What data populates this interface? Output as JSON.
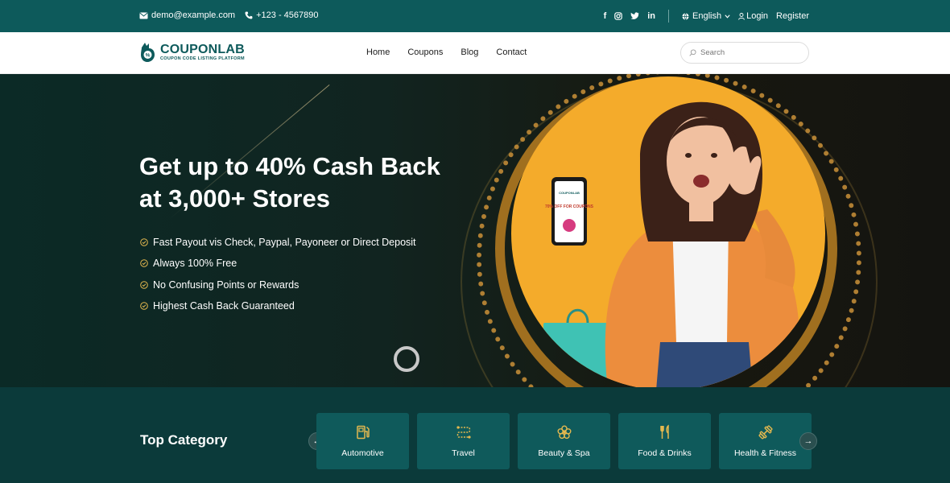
{
  "topbar": {
    "email": "demo@example.com",
    "phone": "+123 - 4567890",
    "social": [
      "f",
      "ig",
      "tw",
      "in"
    ],
    "language": "English",
    "login": "Login",
    "register": "Register"
  },
  "header": {
    "logo_title": "COUPONLAB",
    "logo_subtitle": "COUPON CODE LISTING PLATFORM",
    "nav": [
      "Home",
      "Coupons",
      "Blog",
      "Contact"
    ],
    "search_placeholder": "Search"
  },
  "hero": {
    "title_line1": "Get up to 40% Cash Back",
    "title_line2": "at 3,000+ Stores",
    "bullets": [
      "Fast Payout vis Check, Paypal, Payoneer or Direct Deposit",
      "Always 100% Free",
      "No Confusing Points or Rewards",
      "Highest Cash Back Guaranteed"
    ],
    "phone_screen_text": "70% OFF FOR COUPONS"
  },
  "category": {
    "title": "Top Category",
    "items": [
      {
        "label": "Automotive",
        "icon": "fuel-pump-icon"
      },
      {
        "label": "Travel",
        "icon": "route-icon"
      },
      {
        "label": "Beauty & Spa",
        "icon": "flower-icon"
      },
      {
        "label": "Food & Drinks",
        "icon": "cutlery-icon"
      },
      {
        "label": "Health & Fitness",
        "icon": "dumbbell-icon"
      }
    ]
  },
  "colors": {
    "primary": "#0d5a5b",
    "accent": "#f4ab2b",
    "icon_gold": "#e3b84f"
  }
}
